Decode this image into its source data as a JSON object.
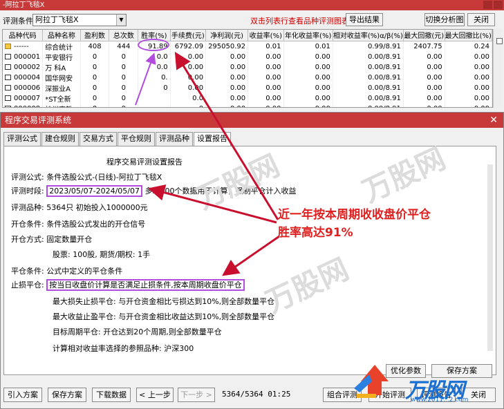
{
  "top_window": {
    "title": "-阿拉丁飞毯X",
    "toolbar": {
      "formula_label": "评测条件:",
      "formula_value": "阿拉丁飞毯X",
      "hint": "双击列表行查看品种评测图表",
      "export_label": "导出结果",
      "switch_label": "切换分析图",
      "close_label": "关闭"
    },
    "columns": [
      "品种代码",
      "品种名称",
      "盈利数",
      "总次数",
      "胜率(%)",
      "手续费(元)",
      "净利润(元)",
      "收益率(%)",
      "年化收益率(%)",
      "相对收益率(%)α/β(%)",
      "最大回撤(元)",
      "最大回撤比(%)"
    ],
    "rows": [
      {
        "code": "------",
        "name": "综合统计",
        "win": "408",
        "total": "444",
        "rate": "91.89",
        "fee": "6792.09",
        "profit": "295050.92",
        "ret": "0.01",
        "annual": "0.01",
        "rel": "0.99/8.91",
        "dd": "2407.75",
        "ddr": "0.24"
      },
      {
        "code": "000001",
        "name": "平安银行",
        "win": "0",
        "total": "0",
        "rate": "0.0",
        "fee": "0.00",
        "profit": "0.00",
        "ret": "0.00",
        "annual": "0.00",
        "rel": "0.00/8.91",
        "dd": "0.00",
        "ddr": "0.00"
      },
      {
        "code": "000002",
        "name": "万 科A",
        "win": "0",
        "total": "0",
        "rate": "0.0",
        "fee": "0.00",
        "profit": "0.00",
        "ret": "0.00",
        "annual": "0.00",
        "rel": "0.00/8.91",
        "dd": "0.00",
        "ddr": "0.00"
      },
      {
        "code": "000004",
        "name": "国华网安",
        "win": "0",
        "total": "0",
        "rate": "0.",
        "fee": "0.00",
        "profit": "0.00",
        "ret": "0.00",
        "annual": "0.00",
        "rel": "0.00/8.91",
        "dd": "0.00",
        "ddr": "0.00"
      },
      {
        "code": "000006",
        "name": "深振业A",
        "win": "0",
        "total": "0",
        "rate": "0",
        "fee": "0.00",
        "profit": "0.00",
        "ret": "0.00",
        "annual": "0.00",
        "rel": "0.00/8.91",
        "dd": "0.00",
        "ddr": "0.00"
      },
      {
        "code": "000007",
        "name": "*ST全新",
        "win": "0",
        "total": "0",
        "rate": "",
        "fee": "0.0",
        "profit": "0.00",
        "ret": "0.00",
        "annual": "0.00",
        "rel": "0.00/8.91",
        "dd": "0.00",
        "ddr": "0.00"
      },
      {
        "code": "000008",
        "name": "神州高铁",
        "win": "0",
        "total": "0",
        "rate": "",
        "fee": "0",
        "profit": "0.00",
        "ret": "0.00",
        "annual": "0.00",
        "rel": "0.00/8.91",
        "dd": "0.00",
        "ddr": "0.00"
      }
    ]
  },
  "dialog": {
    "title": "程序交易评测系统",
    "tabs": [
      "评测公式",
      "建仓规则",
      "交易方式",
      "平仓规则",
      "评测品种",
      "设置报告"
    ],
    "report_title": "程序交易评测设置报告",
    "lines": {
      "formula": "评测公式:  条件选股公式-(日线)-阿拉丁飞毯X",
      "period_label": "评测时段:",
      "period_value": "2023/05/07-2024/05/07",
      "period_note": "多取100个数据用于计算，强制平仓计入收益",
      "variety": "评测品种:  5364只 初始投入1000000元",
      "open_cond": "开仓条件:  条件选股公式发出的开仓信号",
      "open_mode": "开仓方式:  固定数量开仓",
      "open_qty": "股票: 100股, 期货/期权: 1手",
      "close_cond": "平仓条件:  公式中定义的平仓条件",
      "stop_label": "止损平仓:",
      "stop_value": "按当日收盘价计算是否满足止损条件,按本周期收盘价平仓",
      "max_loss": "最大损失止损平仓: 与开仓资金相比亏损达到10%,则全部数量平仓",
      "max_gain": "最大收益止盈平仓: 与开仓资金相比收益达到10%,则全部数量平仓",
      "target": "目标周期平仓:  开仓达到20个周期,则全部数量平仓",
      "benchmark": "计算相对收益率选择的参照品种:  沪深300"
    },
    "panel_buttons": {
      "optimize": "优化参数",
      "save_scheme": "保存方案"
    },
    "bottom": {
      "import": "引入方案",
      "save": "保存方案",
      "download": "下载数据",
      "prev": "< 上一步",
      "next": "下一步 >",
      "status": "5364/5364 01:25",
      "combo": "组合评测",
      "start": "开始评测",
      "report": "评测报告",
      "close": "关闭"
    }
  },
  "annotation": {
    "line1": "近一年按本周期收收盘价平仓",
    "line2": "胜率高达91%"
  },
  "watermark": {
    "brand": "万股网",
    "url": "www.2011...2.com"
  },
  "colors": {
    "title_bar": "#c83a3a",
    "highlight": "#b24be0",
    "annotation": "#e02020",
    "arrow": "#c8102e"
  }
}
